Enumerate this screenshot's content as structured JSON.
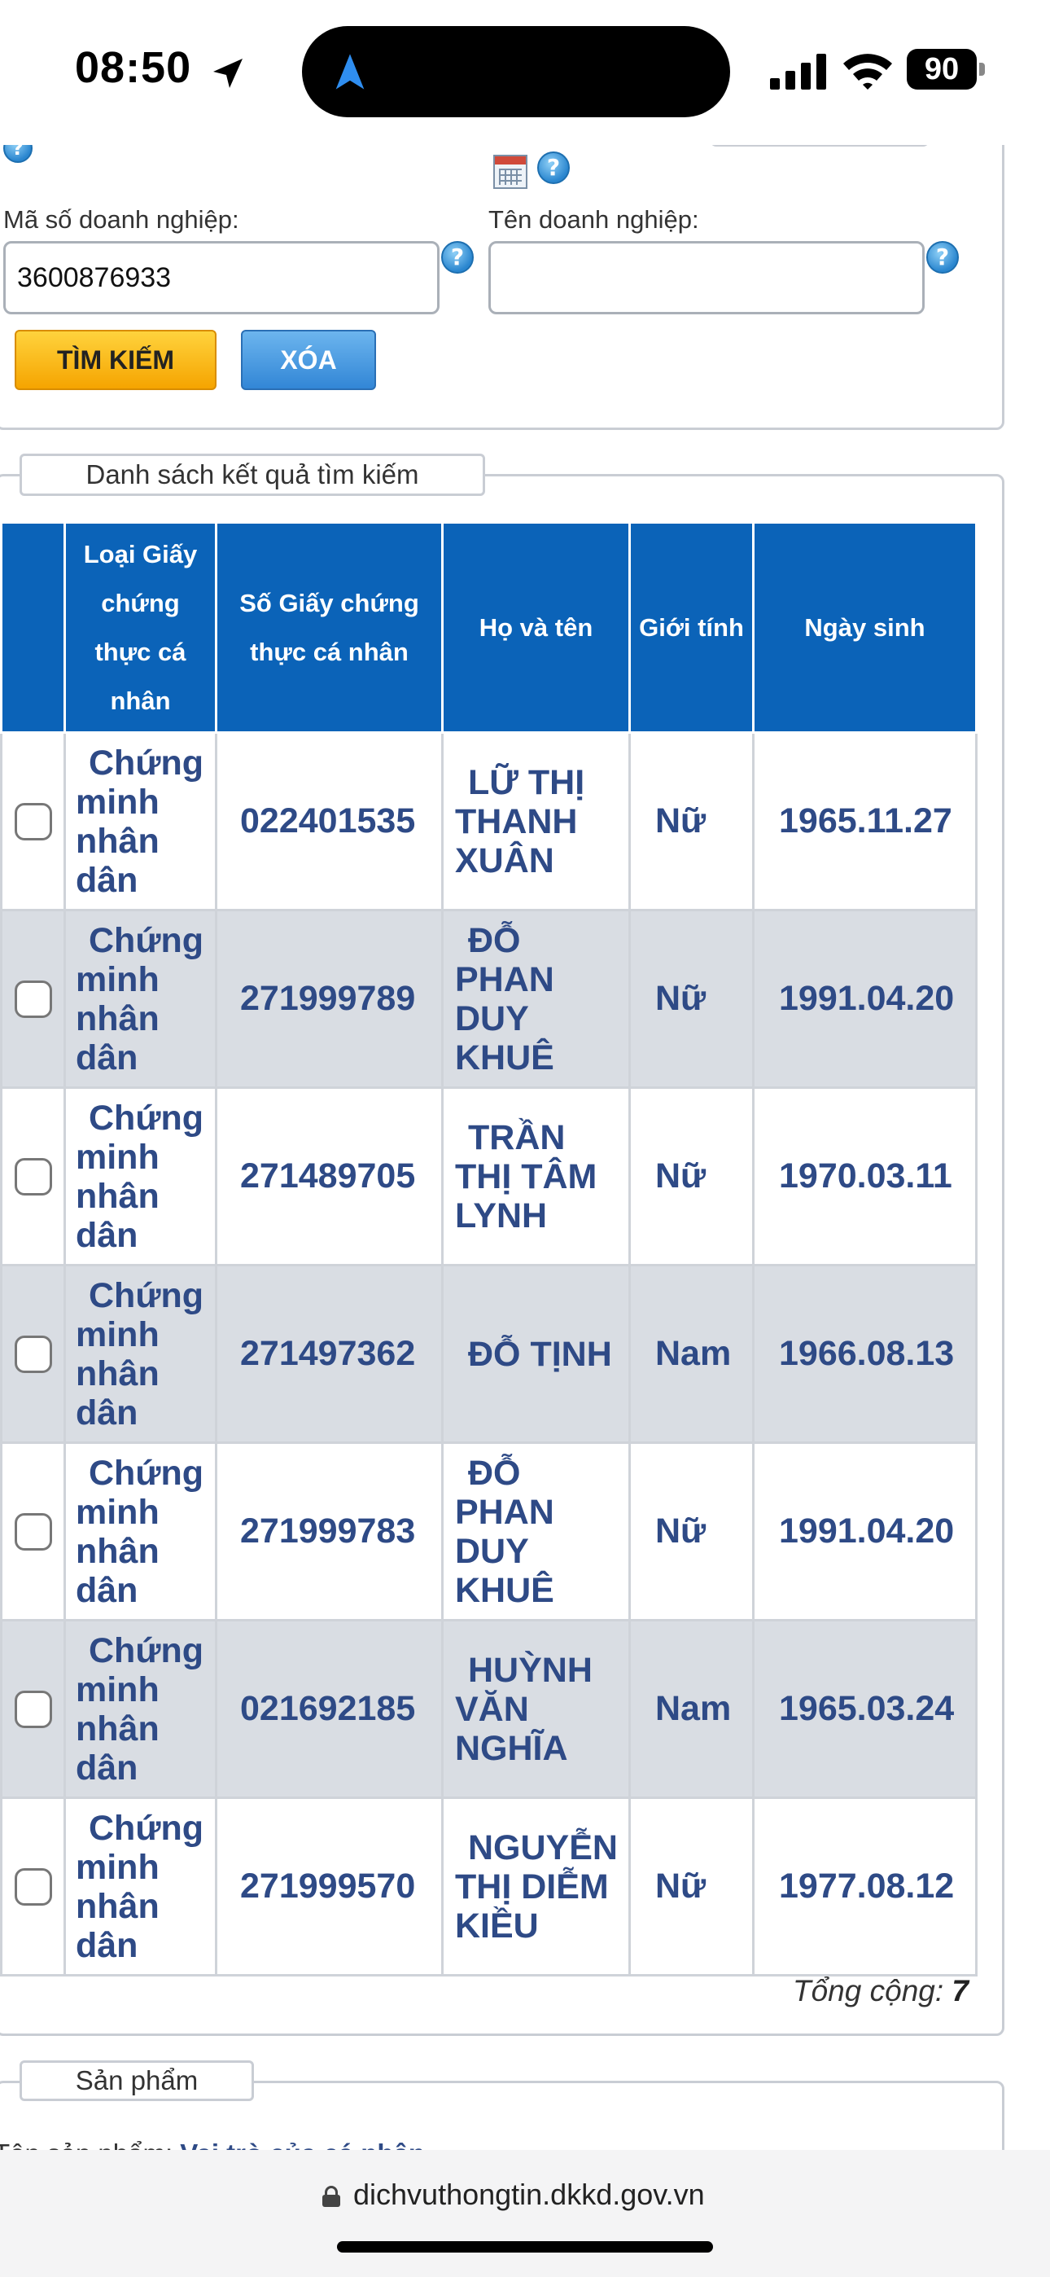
{
  "status_bar": {
    "time": "08:50",
    "battery": "90",
    "icons": [
      "location-arrow-icon",
      "signal-icon",
      "wifi-icon",
      "battery-icon"
    ]
  },
  "form": {
    "tax_code_label": "Mã số doanh nghiệp:",
    "tax_code_value": "3600876933",
    "company_name_label": "Tên doanh nghiệp:",
    "company_name_value": "",
    "help_glyph": "?",
    "search_button": "TÌM KIẾM",
    "clear_button": "XÓA"
  },
  "results": {
    "legend": "Danh sách kết quả tìm kiếm",
    "headers": [
      "",
      "Loại Giấy chứng thực cá nhân",
      "Số Giấy chứng thực cá nhân",
      "Họ và tên",
      "Giới tính",
      "Ngày sinh"
    ],
    "rows": [
      {
        "type": "Chứng minh nhân dân",
        "id_number": "022401535",
        "name": "LỮ THỊ THANH XUÂN",
        "gender": "Nữ",
        "dob": "1965.11.27"
      },
      {
        "type": "Chứng minh nhân dân",
        "id_number": "271999789",
        "name": "ĐỖ PHAN DUY KHUÊ",
        "gender": "Nữ",
        "dob": "1991.04.20"
      },
      {
        "type": "Chứng minh nhân dân",
        "id_number": "271489705",
        "name": "TRẦN THỊ TÂM LYNH",
        "gender": "Nữ",
        "dob": "1970.03.11"
      },
      {
        "type": "Chứng minh nhân dân",
        "id_number": "271497362",
        "name": "ĐỖ TỊNH",
        "gender": "Nam",
        "dob": "1966.08.13"
      },
      {
        "type": "Chứng minh nhân dân",
        "id_number": "271999783",
        "name": "ĐỖ PHAN DUY KHUÊ",
        "gender": "Nữ",
        "dob": "1991.04.20"
      },
      {
        "type": "Chứng minh nhân dân",
        "id_number": "021692185",
        "name": "HUỲNH VĂN NGHĨA",
        "gender": "Nam",
        "dob": "1965.03.24"
      },
      {
        "type": "Chứng minh nhân dân",
        "id_number": "271999570",
        "name": "NGUYỄN THỊ DIỄM KIỀU",
        "gender": "Nữ",
        "dob": "1977.08.12"
      }
    ],
    "total_label": "Tổng cộng:",
    "total_value": "7"
  },
  "product": {
    "legend": "Sản phẩm",
    "cut_label": "Tên sản phẩm:",
    "cut_value": "Vai trò của cá nhân"
  },
  "browser": {
    "url": "dichvuthongtin.dkkd.gov.vn"
  },
  "colors": {
    "header_blue": "#0b63b8",
    "cell_text": "#2e4a86",
    "row_alt": "#d9dde3",
    "search_button": "#f5a400",
    "clear_button": "#3286d6"
  }
}
